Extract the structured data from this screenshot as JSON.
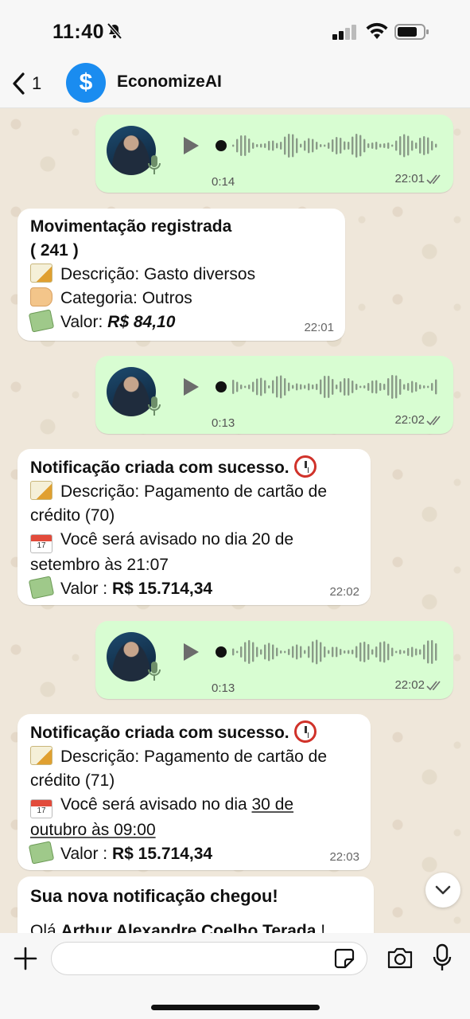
{
  "status": {
    "time": "11:40"
  },
  "header": {
    "back_count": "1",
    "avatar_symbol": "$",
    "contact_name": "EconomizeAI"
  },
  "messages": [
    {
      "type": "voice",
      "duration": "0:14",
      "time": "22:01"
    },
    {
      "type": "text",
      "title": "Movimentação registrada",
      "id_line": "( 241 )",
      "description": "Descrição: Gasto diversos",
      "category": "Categoria: Outros",
      "value_label": "Valor:",
      "value": "R$ 84,10",
      "time": "22:01"
    },
    {
      "type": "voice",
      "duration": "0:13",
      "time": "22:02"
    },
    {
      "type": "text",
      "title": "Notificação criada com sucesso.",
      "description_1": "Descrição: Pagamento de cartão de",
      "description_2": "crédito (70)",
      "notice_1": "Você será avisado no dia 20 de",
      "notice_2": "setembro às 21:07",
      "calendar_day": "17",
      "value_label": "Valor :",
      "value": "R$ 15.714,34",
      "time": "22:02"
    },
    {
      "type": "voice",
      "duration": "0:13",
      "time": "22:02"
    },
    {
      "type": "text",
      "title": "Notificação criada com sucesso.",
      "description_1": "Descrição: Pagamento de cartão de",
      "description_2": "crédito (71)",
      "notice_1a": "Você será avisado no dia ",
      "notice_1b": "30 de",
      "notice_2": "outubro às 09:00",
      "calendar_day": "17",
      "value_label": "Valor :",
      "value": "R$ 15.714,34",
      "time": "22:03"
    },
    {
      "type": "text",
      "title": "Sua nova notificação chegou!",
      "greeting": "Olá ",
      "name": "Arthur Alexandre Coelho Terada",
      "greeting_end": " !"
    }
  ],
  "composer": {
    "placeholder": ""
  },
  "colors": {
    "outgoing": "#d8fdd2",
    "incoming": "#ffffff",
    "accent": "#1a8cf0",
    "ticks": "#6f6f6f"
  }
}
